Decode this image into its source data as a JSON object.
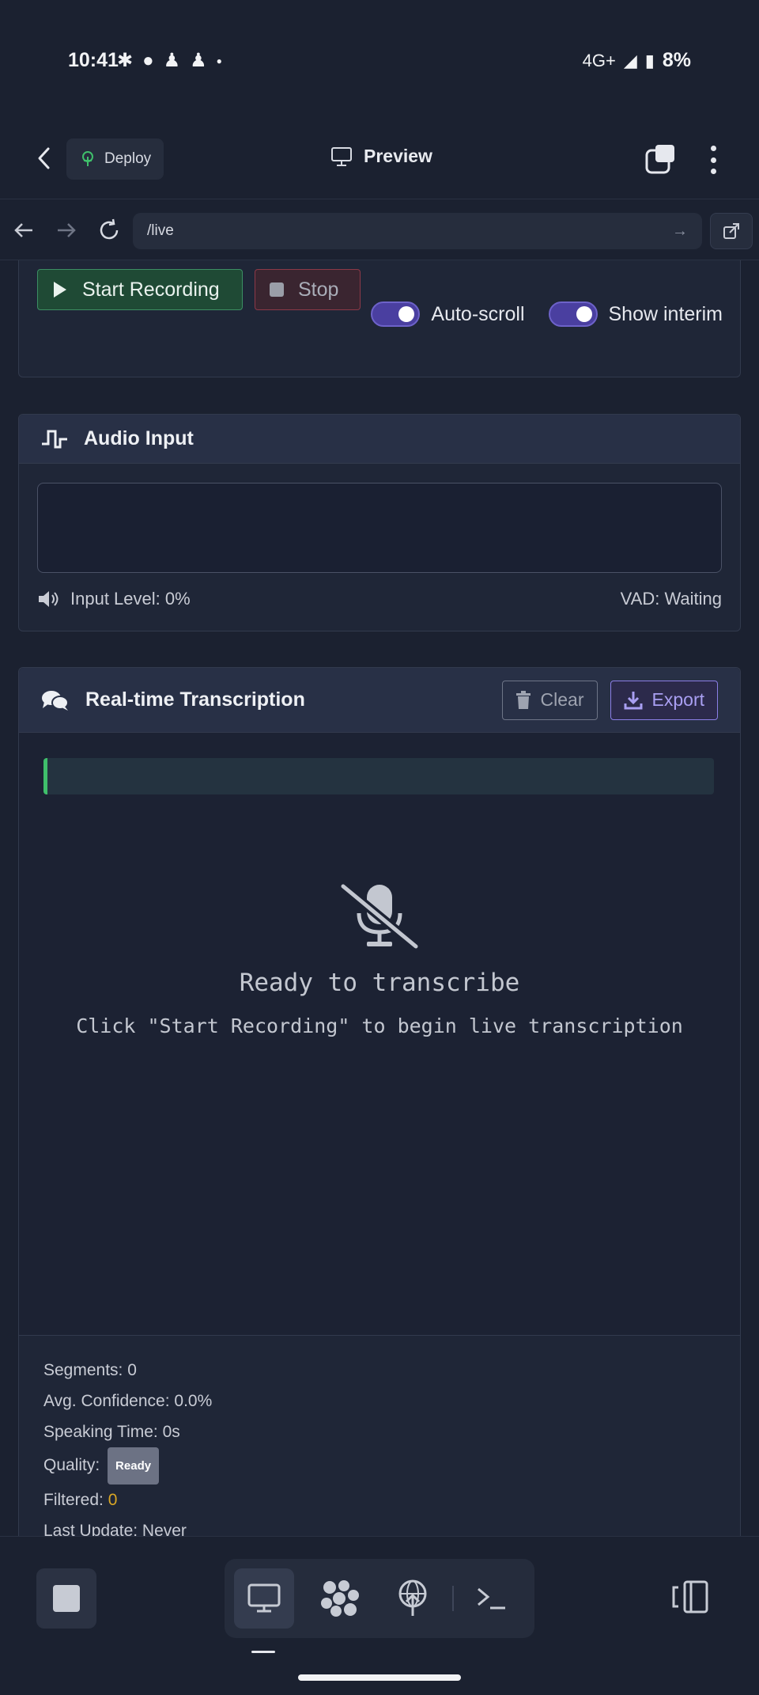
{
  "status_bar": {
    "time": "10:41",
    "network": "4G+",
    "battery": "8%"
  },
  "app_header": {
    "deploy_label": "Deploy",
    "title": "Preview"
  },
  "url_bar": {
    "path": "/live"
  },
  "controls": {
    "start_label": "Start Recording",
    "stop_label": "Stop",
    "toggles": [
      {
        "label": "Auto-scroll",
        "on": true
      },
      {
        "label": "Show interim",
        "on": true
      }
    ]
  },
  "audio_input": {
    "title": "Audio Input",
    "level_label": "Input Level: 0%",
    "vad_label": "VAD: Waiting"
  },
  "transcription": {
    "title": "Real-time Transcription",
    "clear_label": "Clear",
    "export_label": "Export",
    "empty_title": "Ready to transcribe",
    "empty_subtitle": "Click \"Start Recording\" to begin live transcription"
  },
  "stats": {
    "segments": "Segments: 0",
    "avg_confidence": "Avg. Confidence: 0.0%",
    "speaking_time": "Speaking Time: 0s",
    "quality_label": "Quality:",
    "quality_badge": "Ready",
    "filtered_label": "Filtered:",
    "filtered_value": "0",
    "last_update": "Last Update: Never"
  },
  "colors": {
    "background": "#1b2130",
    "accent_purple": "#8b7ee6",
    "start_green": "#3c8f63",
    "stop_red": "#8c3948",
    "interim_green": "#3fbf6b",
    "filtered_yellow": "#d9a625"
  }
}
